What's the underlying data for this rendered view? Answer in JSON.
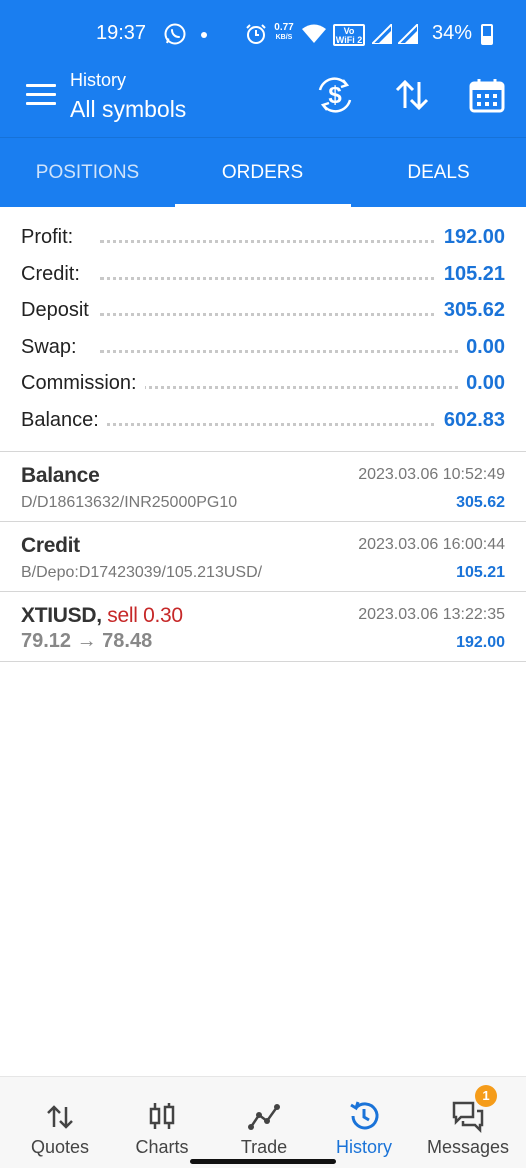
{
  "status_bar": {
    "time": "19:37",
    "net_speed": "0.77",
    "net_speed_unit": "KB/S",
    "vowifi_line1": "Vo",
    "vowifi_line2": "WiFi 2",
    "battery": "34%"
  },
  "header": {
    "subtitle": "History",
    "title": "All symbols",
    "icons": [
      "menu-icon",
      "currency-exchange-icon",
      "sort-icon",
      "calendar-icon"
    ]
  },
  "tabs": [
    {
      "label": "POSITIONS",
      "active": false
    },
    {
      "label": "ORDERS",
      "active": true
    },
    {
      "label": "DEALS",
      "active": false
    }
  ],
  "summary": [
    {
      "label": "Profit:",
      "value": "192.00"
    },
    {
      "label": "Credit:",
      "value": "105.21"
    },
    {
      "label": "Deposit",
      "value": "305.62"
    },
    {
      "label": "Swap:",
      "value": "0.00"
    },
    {
      "label": "Commission:",
      "value": "0.00"
    },
    {
      "label": "Balance:",
      "value": "602.83"
    }
  ],
  "deals": [
    {
      "title": "Balance",
      "sub": "D/D18613632/INR25000PG10",
      "time": "2023.03.06 10:52:49",
      "amount": "305.62"
    },
    {
      "title": "Credit",
      "sub": "B/Depo:D17423039/105.213USD/",
      "time": "2023.03.06 16:00:44",
      "amount": "105.21"
    },
    {
      "symbol": "XTIUSD,",
      "side": "sell 0.30",
      "prices": "79.12 → 78.48",
      "time": "2023.03.06 13:22:35",
      "amount": "192.00"
    }
  ],
  "bottom_nav": [
    {
      "label": "Quotes",
      "icon": "quotes-icon"
    },
    {
      "label": "Charts",
      "icon": "charts-icon"
    },
    {
      "label": "Trade",
      "icon": "trade-icon"
    },
    {
      "label": "History",
      "icon": "history-icon",
      "active": true
    },
    {
      "label": "Messages",
      "icon": "messages-icon",
      "badge": "1"
    }
  ],
  "colors": {
    "header_blue": "#1a7ef0",
    "value_blue": "#1a73d8",
    "sell_red": "#c62828",
    "badge_orange": "#f59c1a"
  }
}
